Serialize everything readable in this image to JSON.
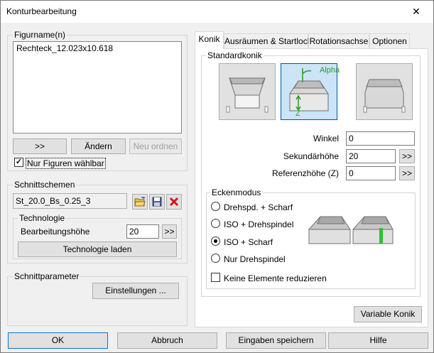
{
  "window": {
    "title": "Konturbearbeitung",
    "close_glyph": "✕"
  },
  "figurname": {
    "group_label": "Figurname(n)",
    "items": [
      "Rechteck_12.023x10.618"
    ],
    "btn_move": ">>",
    "btn_change": "Ändern",
    "btn_reorder": "Neu ordnen",
    "only_figures_label": "Nur Figuren wählbar",
    "only_figures_checked": true
  },
  "schnittschemen": {
    "group_label": "Schnittschemen",
    "value": "St_20.0_Bs_0.25_3",
    "technologie": {
      "group_label": "Technologie",
      "height_label": "Bearbeitungshöhe",
      "height_value": "20",
      "height_btn": ">>",
      "load_btn": "Technologie laden"
    }
  },
  "schnittparameter": {
    "group_label": "Schnittparameter",
    "settings_btn": "Einstellungen ..."
  },
  "tabs": [
    "Konik",
    "Ausräumen & Startloch",
    "Rotationsachse",
    "Optionen"
  ],
  "konik": {
    "standard_label": "Standardkonik",
    "alpha_label": "Alpha",
    "z_label": "Z",
    "winkel_label": "Winkel",
    "winkel_value": "0",
    "sek_label": "Sekundärhöhe",
    "sek_value": "20",
    "sek_btn": ">>",
    "ref_label": "Referenzhöhe (Z)",
    "ref_value": "0",
    "ref_btn": ">>",
    "ecken_label": "Eckenmodus",
    "ecken_options": [
      "Drehspd. + Scharf",
      "ISO + Drehspindel",
      "ISO + Scharf",
      "Nur Drehspindel"
    ],
    "ecken_selected": 2,
    "reduce_label": "Keine Elemente reduzieren",
    "reduce_checked": false,
    "variable_btn": "Variable Konik"
  },
  "footer": {
    "ok": "OK",
    "cancel": "Abbruch",
    "save": "Eingaben speichern",
    "help": "Hilfe"
  }
}
